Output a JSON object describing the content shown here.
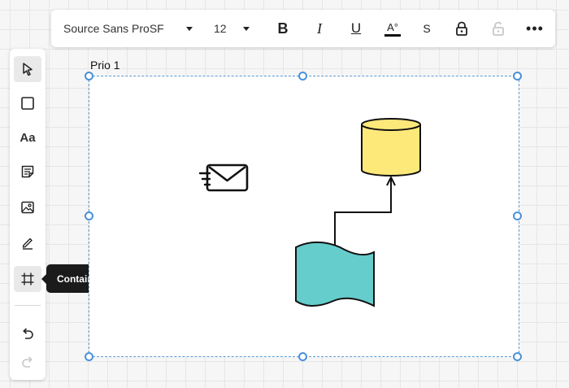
{
  "toolbar": {
    "font_family": "Source Sans ProSF",
    "font_size": "12",
    "bold_label": "B",
    "italic_label": "I",
    "underline_label": "U",
    "text_color_label": "A°",
    "strike_label": "S",
    "more_label": "•••"
  },
  "tools": {
    "text_label": "Aa"
  },
  "tooltip": {
    "label": "Container"
  },
  "frame": {
    "title": "Prio 1"
  },
  "colors": {
    "database_fill": "#fde97a",
    "document_fill": "#65cdcb",
    "selection": "#4a90d9"
  }
}
